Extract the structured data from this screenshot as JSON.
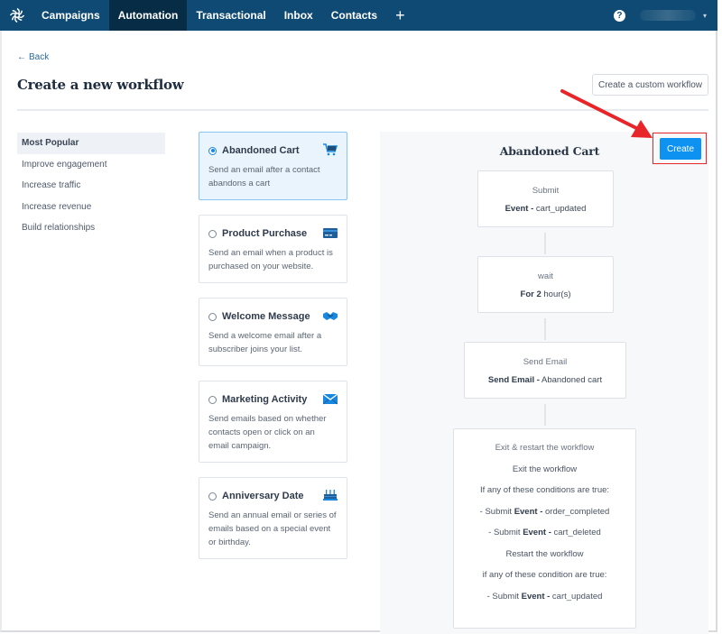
{
  "nav": {
    "logo_icon": "sendinblue-swirl-icon",
    "items": [
      {
        "label": "Campaigns",
        "active": false
      },
      {
        "label": "Automation",
        "active": true
      },
      {
        "label": "Transactional",
        "active": false
      },
      {
        "label": "Inbox",
        "active": false
      },
      {
        "label": "Contacts",
        "active": false
      }
    ],
    "add_label": "+",
    "help_label": "?",
    "caret": "▾"
  },
  "header": {
    "back_label": "Back",
    "back_icon": "←",
    "title": "Create a new workflow",
    "custom_button_label": "Create a custom workflow"
  },
  "sidebar": {
    "items": [
      {
        "label": "Most Popular",
        "active": true
      },
      {
        "label": "Improve engagement",
        "active": false
      },
      {
        "label": "Increase traffic",
        "active": false
      },
      {
        "label": "Increase revenue",
        "active": false
      },
      {
        "label": "Build relationships",
        "active": false
      }
    ]
  },
  "templates": [
    {
      "title": "Abandoned Cart",
      "description": "Send an email after a contact abandons a cart",
      "icon": "shopping-cart-icon",
      "selected": true
    },
    {
      "title": "Product Purchase",
      "description": "Send an email when a product is purchased on your website.",
      "icon": "credit-card-icon",
      "selected": false
    },
    {
      "title": "Welcome Message",
      "description": "Send a welcome email after a subscriber joins your list.",
      "icon": "handshake-icon",
      "selected": false
    },
    {
      "title": "Marketing Activity",
      "description": "Send emails based on whether contacts open or click on an email campaign.",
      "icon": "envelope-icon",
      "selected": false
    },
    {
      "title": "Anniversary Date",
      "description": "Send an annual email or series of emails based on a special event or birthday.",
      "icon": "birthday-cake-icon",
      "selected": false
    }
  ],
  "preview": {
    "title": "Abandoned Cart",
    "create_label": "Create",
    "steps": [
      {
        "label": "Submit",
        "detail_bold": "Event -",
        "detail": " cart_updated"
      },
      {
        "label": "wait",
        "detail_bold": "For 2",
        "detail": " hour(s)"
      },
      {
        "label": "Send Email",
        "detail_bold": "Send Email -",
        "detail": " Abandoned cart"
      }
    ],
    "exit": {
      "label": "Exit & restart the workflow",
      "exit_heading": "Exit the workflow",
      "exit_condition": "If any of these conditions are true:",
      "exit_rules": [
        {
          "prefix": "- Submit ",
          "bold": "Event -",
          "value": " order_completed"
        },
        {
          "prefix": "- Submit ",
          "bold": "Event -",
          "value": " cart_deleted"
        }
      ],
      "restart_heading": "Restart the workflow",
      "restart_condition": "if any of these condition are true:",
      "restart_rules": [
        {
          "prefix": "- Submit ",
          "bold": "Event -",
          "value": " cart_updated"
        }
      ]
    }
  },
  "annotation": {
    "arrow_color": "#e8262a",
    "highlight_color": "#e8262a"
  },
  "colors": {
    "nav_bg": "#0e4a73",
    "nav_active": "#072d46",
    "primary": "#0d92f2",
    "selected_card_bg": "#e9f4fd"
  }
}
